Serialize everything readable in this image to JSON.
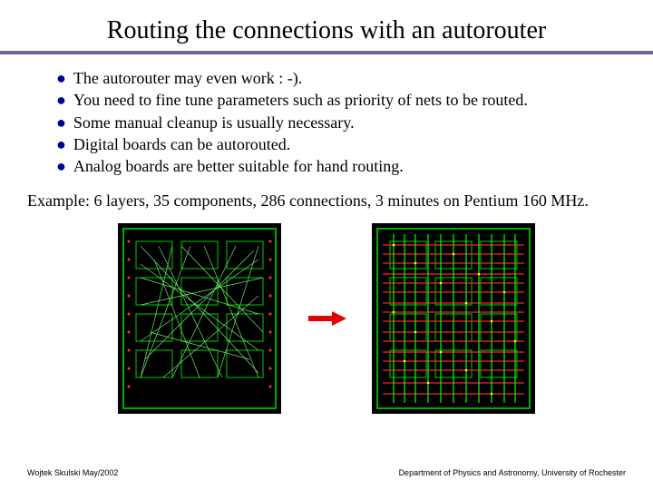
{
  "title": "Routing the connections with an autorouter",
  "bullets": [
    "The autorouter may even work : -).",
    "You need to fine tune parameters such as priority of nets to be routed.",
    "Some manual cleanup is usually necessary.",
    "Digital boards can be autorouted.",
    "Analog boards are better suitable for hand routing."
  ],
  "example": "Example: 6 layers, 35 components, 286 connections, 3 minutes on Pentium 160 MHz.",
  "footer": {
    "left": "Wojtek Skulski May/2002",
    "right": "Department of Physics and Astronomy, University of Rochester"
  }
}
